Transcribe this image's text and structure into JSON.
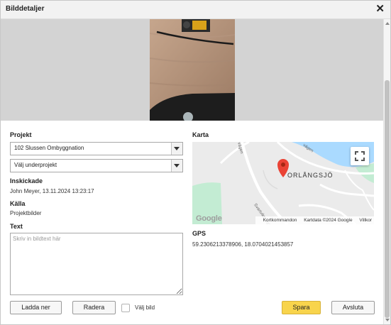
{
  "dialog": {
    "title": "Bilddetaljer",
    "close_icon": "close-icon"
  },
  "form": {
    "project_label": "Projekt",
    "project_value": "102 Slussen Ombyggnation",
    "subproject_value": "Välj underprojekt",
    "submitted_label": "Inskickade",
    "submitted_value": "John Meyer, 13.11.2024 13:23:17",
    "source_label": "Källa",
    "source_value": "Projektbilder",
    "text_label": "Text",
    "text_placeholder": "Skriv in bildtext här"
  },
  "map": {
    "label": "Karta",
    "place_name": "ORLÅNGSJÖ",
    "road_1": "Svartviksvägen",
    "road_2": "vägen",
    "road_3": "vägen",
    "google": "Google",
    "attribution": {
      "shortcuts": "Kortkommandon",
      "data": "Kartdata ©2024 Google",
      "terms": "Villkor"
    },
    "colors": {
      "water": "#aadaff",
      "land": "#e8e8e8",
      "road": "#ffffff",
      "park": "#c3ecd3",
      "pin": "#ea4335"
    }
  },
  "gps": {
    "label": "GPS",
    "value": "59.2306213378906, 18.0704021453857"
  },
  "actions": {
    "download": "Ladda ner",
    "delete": "Radera",
    "select_image": "Välj bild",
    "save": "Spara",
    "close": "Avsluta"
  },
  "colors": {
    "primary_button": "#f8d44c"
  }
}
